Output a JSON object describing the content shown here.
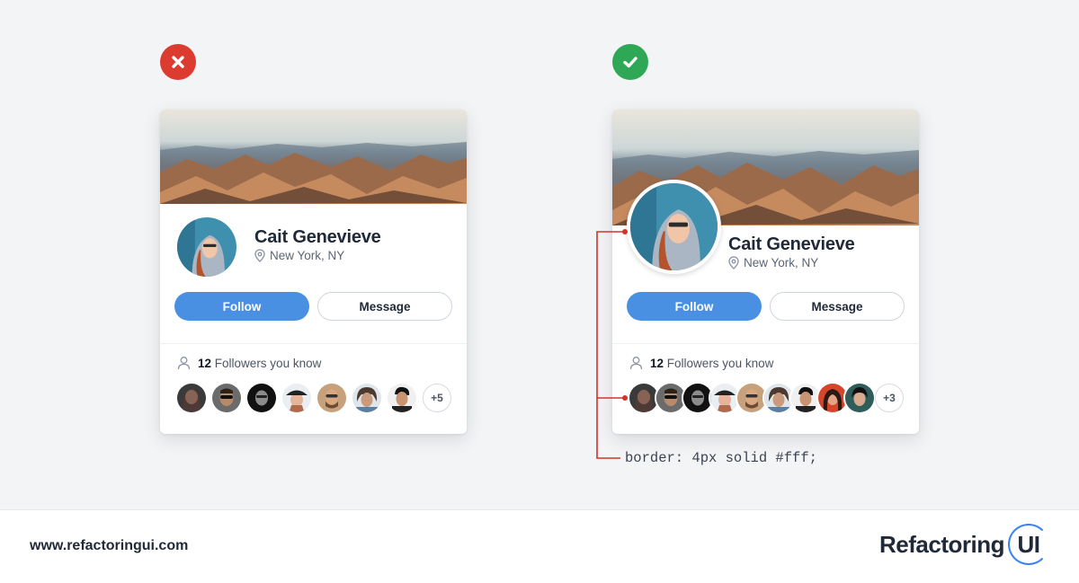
{
  "badges": {
    "bad": "x-icon",
    "good": "check-icon"
  },
  "cards": {
    "bad": {
      "name": "Cait Genevieve",
      "location": "New York, NY",
      "follow_label": "Follow",
      "message_label": "Message",
      "followers_count": "12",
      "followers_text": "Followers you know",
      "more_label": "+5"
    },
    "good": {
      "name": "Cait Genevieve",
      "location": "New York, NY",
      "follow_label": "Follow",
      "message_label": "Message",
      "followers_count": "12",
      "followers_text": "Followers you know",
      "more_label": "+3"
    }
  },
  "annotation": "border: 4px solid #fff;",
  "footer": {
    "site": "www.refactoringui.com",
    "brand_text": "Refactoring",
    "brand_ui": "UI"
  },
  "colors": {
    "accent": "#4a90e2",
    "bad": "#dc3b2f",
    "good": "#2fa855",
    "annotation": "#d0342c"
  }
}
